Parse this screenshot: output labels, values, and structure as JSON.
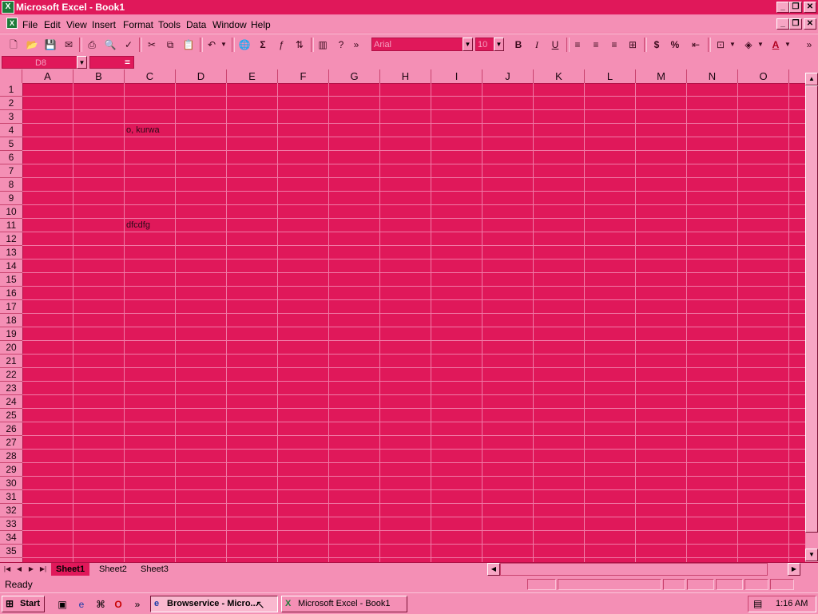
{
  "window": {
    "title": "Microsoft Excel - Book1"
  },
  "menu": [
    "File",
    "Edit",
    "View",
    "Insert",
    "Format",
    "Tools",
    "Data",
    "Window",
    "Help"
  ],
  "toolbar": {
    "font_name": "Arial",
    "font_size": "10"
  },
  "formula_bar": {
    "name_box": "D8",
    "equals": "="
  },
  "columns": [
    "A",
    "B",
    "C",
    "D",
    "E",
    "F",
    "G",
    "H",
    "I",
    "J",
    "K",
    "L",
    "M",
    "N",
    "O"
  ],
  "rows": [
    "1",
    "2",
    "3",
    "4",
    "5",
    "6",
    "7",
    "8",
    "9",
    "10",
    "11",
    "12",
    "13",
    "14",
    "15",
    "16",
    "17",
    "18",
    "19",
    "20",
    "21",
    "22",
    "23",
    "24",
    "25",
    "26",
    "27",
    "28",
    "29",
    "30",
    "31",
    "32",
    "33",
    "34",
    "35"
  ],
  "cells": {
    "C4": "o, kurwa",
    "C11": "dfcdfg"
  },
  "sheets": [
    "Sheet1",
    "Sheet2",
    "Sheet3"
  ],
  "status": {
    "text": "Ready"
  },
  "taskbar": {
    "start": "Start",
    "buttons": [
      "Browservice - Micro...",
      "Microsoft Excel - Book1"
    ],
    "time": "1:16 AM"
  },
  "colors": {
    "title": "#e0185a",
    "grid": "#e0185a",
    "chrome": "#f48fb5"
  }
}
